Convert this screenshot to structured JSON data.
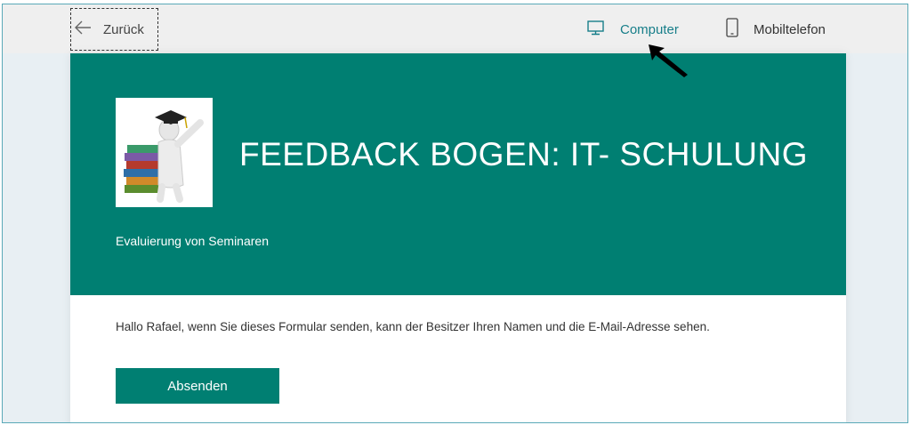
{
  "topbar": {
    "back_label": "Zurück",
    "views": [
      {
        "label": "Computer",
        "icon": "monitor-icon",
        "active": true
      },
      {
        "label": "Mobiltelefon",
        "icon": "phone-icon",
        "active": false
      }
    ]
  },
  "form": {
    "title": "FEEDBACK BOGEN: IT- SCHULUNG",
    "subtitle": "Evaluierung von Seminaren",
    "logo_icon": "graduate-books-image",
    "notice": "Hallo Rafael, wenn Sie dieses Formular senden, kann der Besitzer Ihren Namen und die E-Mail-Adresse sehen.",
    "submit_label": "Absenden"
  },
  "colors": {
    "accent": "#007f72",
    "active_view": "#177e89",
    "page_background": "#e8eff3"
  }
}
